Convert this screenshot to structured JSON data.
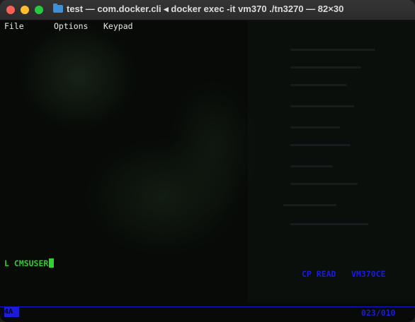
{
  "window": {
    "title": "test — com.docker.cli ◂ docker exec -it vm370 ./tn3270 — 82×30",
    "traffic_lights": [
      "close",
      "minimize",
      "maximize"
    ]
  },
  "menubar": {
    "items": [
      "File",
      "Options",
      "Keypad"
    ]
  },
  "terminal": {
    "command_line": "L CMSUSER",
    "status_left": "CP READ",
    "status_right": "VM370CE",
    "oia_indicator": "4A",
    "cursor_position": "023/010"
  },
  "colors": {
    "green": "#34c934",
    "blue": "#1a1ae0"
  }
}
